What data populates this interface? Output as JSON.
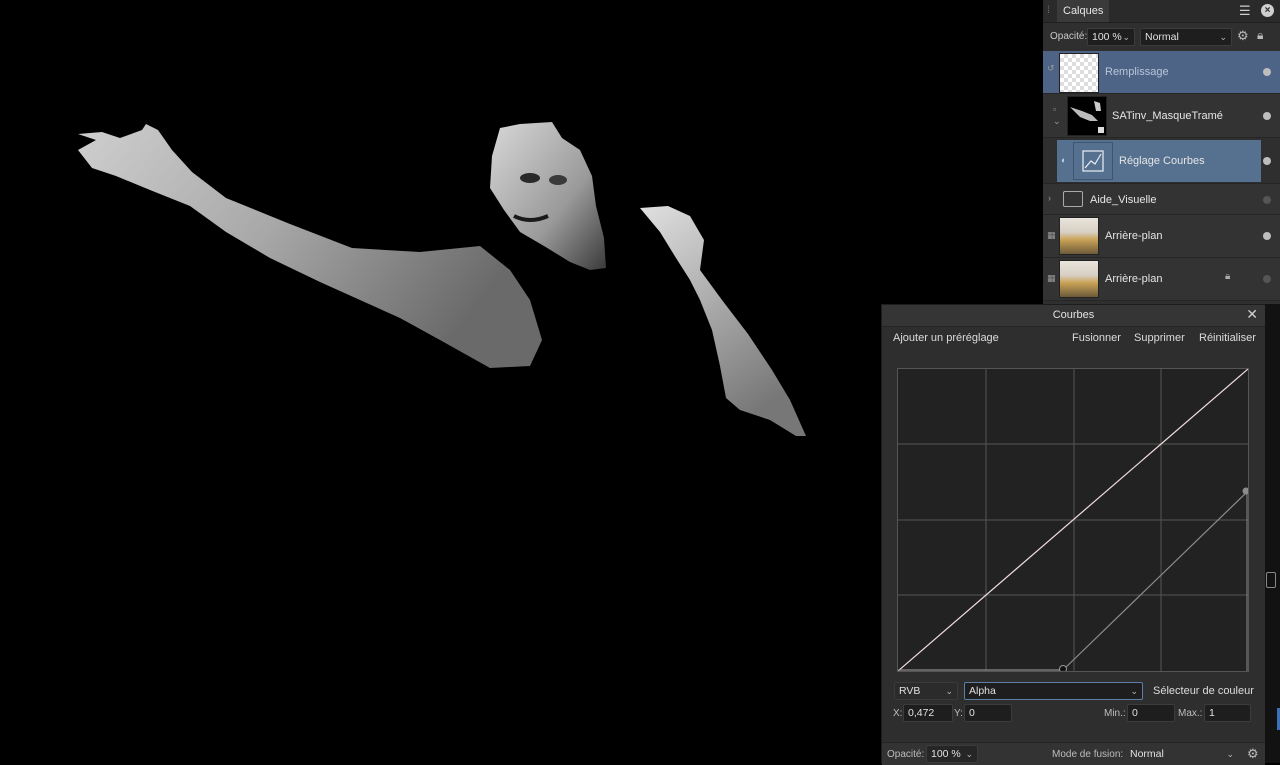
{
  "layers_panel": {
    "tab_title": "Calques",
    "opacity_label": "Opacité:",
    "opacity_value": "100 %",
    "blend_mode": "Normal",
    "layers": [
      {
        "name": "Remplissage",
        "selected": true,
        "visible": true
      },
      {
        "name": "SATinv_MasqueTramé",
        "selected": false,
        "visible": true
      },
      {
        "name": "Réglage Courbes",
        "selected": true,
        "visible": true
      },
      {
        "name": "Aide_Visuelle",
        "selected": false,
        "visible": false
      },
      {
        "name": "Arrière-plan",
        "selected": false,
        "visible": true
      },
      {
        "name": "Arrière-plan",
        "selected": false,
        "visible": false,
        "locked": true
      }
    ]
  },
  "curves_panel": {
    "title": "Courbes",
    "add_preset": "Ajouter un préréglage",
    "merge": "Fusionner",
    "delete": "Supprimer",
    "reset": "Réinitialiser",
    "channel": "RVB",
    "sub_channel": "Alpha",
    "color_picker": "Sélecteur de couleur",
    "x_label": "X:",
    "x_value": "0,472",
    "y_label": "Y:",
    "y_value": "0",
    "min_label": "Min.:",
    "min_value": "0",
    "max_label": "Max.:",
    "max_value": "1",
    "opacity_label": "Opacité:",
    "opacity_value": "100 %",
    "blend_label": "Mode de fusion:",
    "blend_value": "Normal",
    "colors": {
      "rgb_curve": "#f3dede",
      "alpha_curve": "#8c8c8c",
      "grid": "#555555"
    }
  },
  "colors": {
    "accent_selected": "#4d6486",
    "panel_bg": "#2f2f2f",
    "canvas_bg": "#000000"
  }
}
